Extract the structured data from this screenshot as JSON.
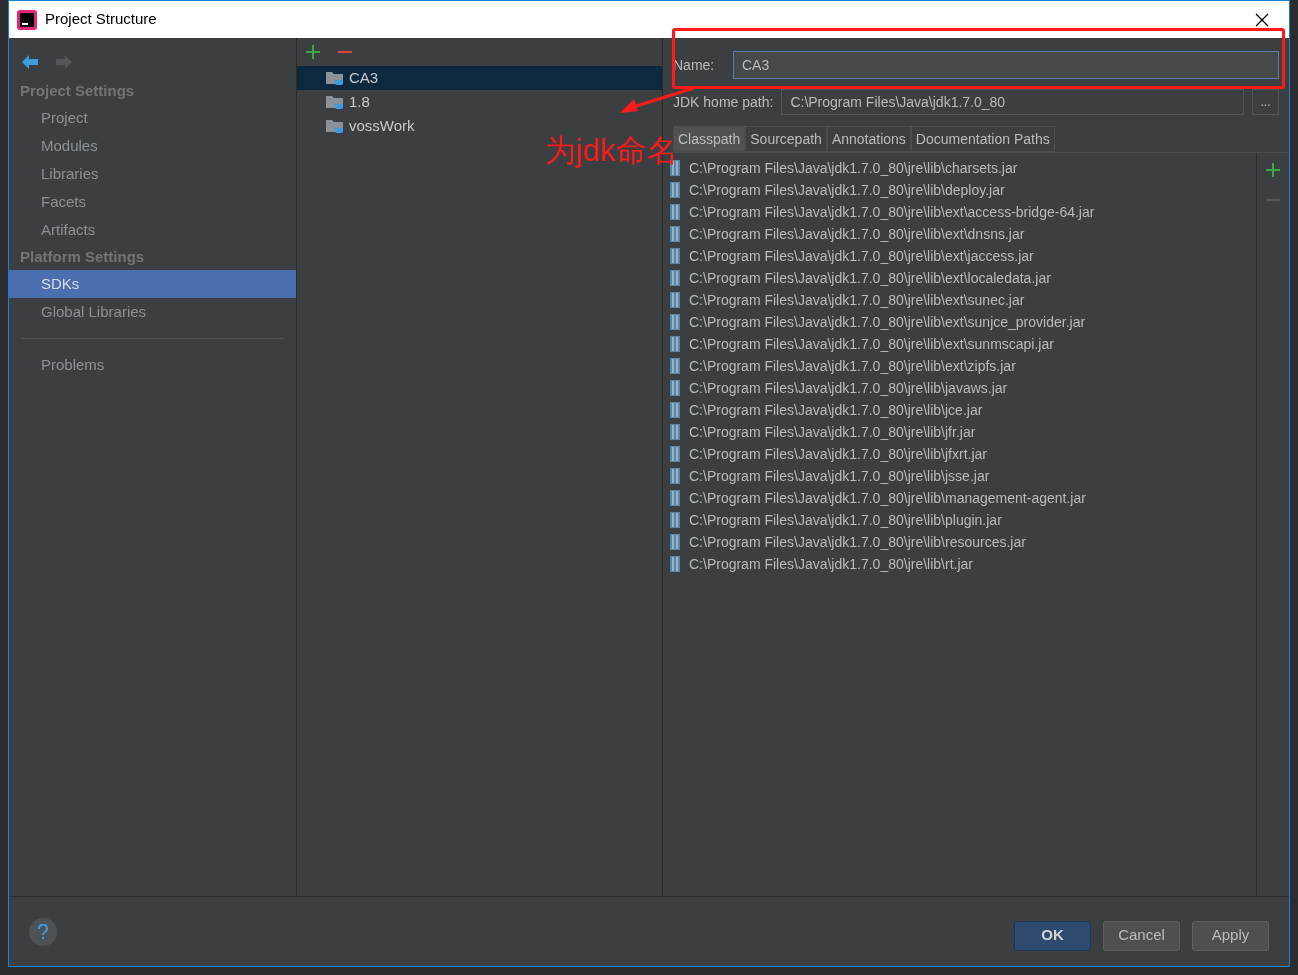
{
  "window": {
    "title": "Project Structure"
  },
  "sidebar": {
    "groups": [
      {
        "title": "Project Settings",
        "items": [
          {
            "label": "Project",
            "selected": false
          },
          {
            "label": "Modules",
            "selected": false
          },
          {
            "label": "Libraries",
            "selected": false
          },
          {
            "label": "Facets",
            "selected": false
          },
          {
            "label": "Artifacts",
            "selected": false
          }
        ]
      },
      {
        "title": "Platform Settings",
        "items": [
          {
            "label": "SDKs",
            "selected": true
          },
          {
            "label": "Global Libraries",
            "selected": false
          }
        ]
      }
    ],
    "footer_items": [
      {
        "label": "Problems",
        "selected": false
      }
    ]
  },
  "sdk_list": {
    "items": [
      {
        "name": "CA3",
        "selected": true
      },
      {
        "name": "1.8",
        "selected": false
      },
      {
        "name": "vossWork",
        "selected": false
      }
    ]
  },
  "details": {
    "name_label": "Name:",
    "name_value": "CA3",
    "home_label": "JDK home path:",
    "home_value": "C:\\Program Files\\Java\\jdk1.7.0_80",
    "browse": "...",
    "tabs": [
      {
        "label": "Classpath",
        "selected": true
      },
      {
        "label": "Sourcepath",
        "selected": false
      },
      {
        "label": "Annotations",
        "selected": false
      },
      {
        "label": "Documentation Paths",
        "selected": false
      }
    ],
    "classpath": [
      "C:\\Program Files\\Java\\jdk1.7.0_80\\jre\\lib\\charsets.jar",
      "C:\\Program Files\\Java\\jdk1.7.0_80\\jre\\lib\\deploy.jar",
      "C:\\Program Files\\Java\\jdk1.7.0_80\\jre\\lib\\ext\\access-bridge-64.jar",
      "C:\\Program Files\\Java\\jdk1.7.0_80\\jre\\lib\\ext\\dnsns.jar",
      "C:\\Program Files\\Java\\jdk1.7.0_80\\jre\\lib\\ext\\jaccess.jar",
      "C:\\Program Files\\Java\\jdk1.7.0_80\\jre\\lib\\ext\\localedata.jar",
      "C:\\Program Files\\Java\\jdk1.7.0_80\\jre\\lib\\ext\\sunec.jar",
      "C:\\Program Files\\Java\\jdk1.7.0_80\\jre\\lib\\ext\\sunjce_provider.jar",
      "C:\\Program Files\\Java\\jdk1.7.0_80\\jre\\lib\\ext\\sunmscapi.jar",
      "C:\\Program Files\\Java\\jdk1.7.0_80\\jre\\lib\\ext\\zipfs.jar",
      "C:\\Program Files\\Java\\jdk1.7.0_80\\jre\\lib\\javaws.jar",
      "C:\\Program Files\\Java\\jdk1.7.0_80\\jre\\lib\\jce.jar",
      "C:\\Program Files\\Java\\jdk1.7.0_80\\jre\\lib\\jfr.jar",
      "C:\\Program Files\\Java\\jdk1.7.0_80\\jre\\lib\\jfxrt.jar",
      "C:\\Program Files\\Java\\jdk1.7.0_80\\jre\\lib\\jsse.jar",
      "C:\\Program Files\\Java\\jdk1.7.0_80\\jre\\lib\\management-agent.jar",
      "C:\\Program Files\\Java\\jdk1.7.0_80\\jre\\lib\\plugin.jar",
      "C:\\Program Files\\Java\\jdk1.7.0_80\\jre\\lib\\resources.jar",
      "C:\\Program Files\\Java\\jdk1.7.0_80\\jre\\lib\\rt.jar"
    ]
  },
  "buttons": [
    {
      "label": "OK",
      "default": true
    },
    {
      "label": "Cancel",
      "default": false
    },
    {
      "label": "Apply",
      "default": false
    }
  ],
  "annotation": {
    "text": "为jdk命名"
  }
}
